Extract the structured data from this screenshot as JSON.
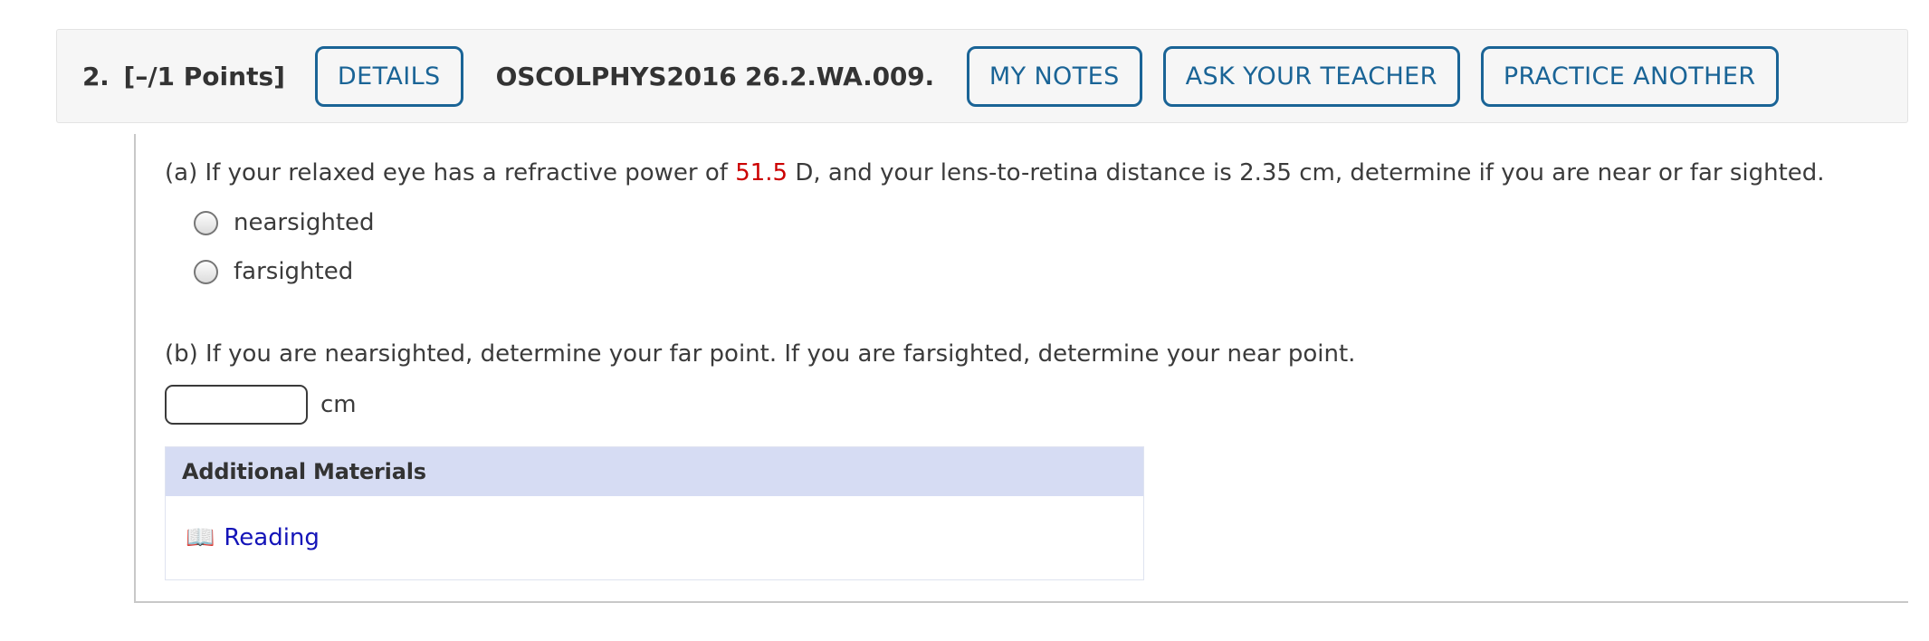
{
  "header": {
    "question_number": "2.",
    "points": "[–/1 Points]",
    "details_label": "DETAILS",
    "question_code": "OSCOLPHYS2016 26.2.WA.009.",
    "my_notes_label": "MY NOTES",
    "ask_teacher_label": "ASK YOUR TEACHER",
    "practice_another_label": "PRACTICE ANOTHER",
    "accent_color": "#1a6496",
    "bar_background": "#f6f6f6"
  },
  "part_a": {
    "text_before_value": "(a) If your relaxed eye has a refractive power of ",
    "value": "51.5",
    "value_color": "#cc0000",
    "text_after_value": " D, and your lens-to-retina distance is 2.35 cm, determine if you are near or far sighted.",
    "options": [
      {
        "label": "nearsighted",
        "selected": false
      },
      {
        "label": "farsighted",
        "selected": false
      }
    ]
  },
  "part_b": {
    "text": "(b) If you are nearsighted, determine your far point. If you are farsighted, determine your near point.",
    "answer_value": "",
    "answer_placeholder": "",
    "unit": "cm"
  },
  "additional_materials": {
    "title": "Additional Materials",
    "header_color": "#d6dcf3",
    "items": [
      {
        "icon": "open-book-icon",
        "glyph": "📖",
        "label": "Reading",
        "link_color": "#1414b8"
      }
    ]
  }
}
